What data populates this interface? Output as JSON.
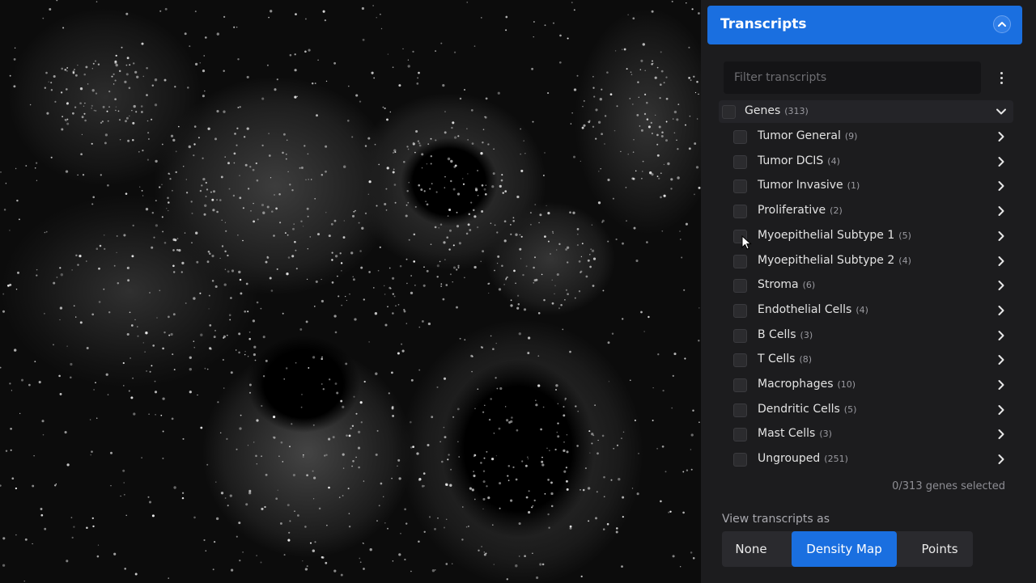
{
  "panel": {
    "title": "Transcripts",
    "filter_placeholder": "Filter transcripts",
    "genes_label": "Genes",
    "genes_count": "(313)",
    "groups": [
      {
        "label": "Tumor General",
        "count": "(9)"
      },
      {
        "label": "Tumor DCIS",
        "count": "(4)"
      },
      {
        "label": "Tumor Invasive",
        "count": "(1)"
      },
      {
        "label": "Proliferative",
        "count": "(2)"
      },
      {
        "label": "Myoepithelial Subtype 1",
        "count": "(5)"
      },
      {
        "label": "Myoepithelial Subtype 2",
        "count": "(4)"
      },
      {
        "label": "Stroma",
        "count": "(6)"
      },
      {
        "label": "Endothelial Cells",
        "count": "(4)"
      },
      {
        "label": "B Cells",
        "count": "(3)"
      },
      {
        "label": "T Cells",
        "count": "(8)"
      },
      {
        "label": "Macrophages",
        "count": "(10)"
      },
      {
        "label": "Dendritic Cells",
        "count": "(5)"
      },
      {
        "label": "Mast Cells",
        "count": "(3)"
      },
      {
        "label": "Ungrouped",
        "count": "(251)"
      }
    ],
    "selected_text": "0/313 genes selected",
    "view_as_label": "View transcripts as",
    "view_options": [
      "None",
      "Density Map",
      "Points"
    ],
    "active_view": "Density Map"
  },
  "colors": {
    "accent": "#1a6fe0",
    "panel_bg": "#1c1c1e",
    "viewer_bg": "#0c0c0c"
  },
  "icons": {
    "collapse": "chevron-up-icon",
    "genes_toggle": "chevron-down-icon",
    "group_expand": "chevron-right-icon",
    "more": "more-vertical-icon",
    "cursor": "mouse-pointer-icon"
  }
}
